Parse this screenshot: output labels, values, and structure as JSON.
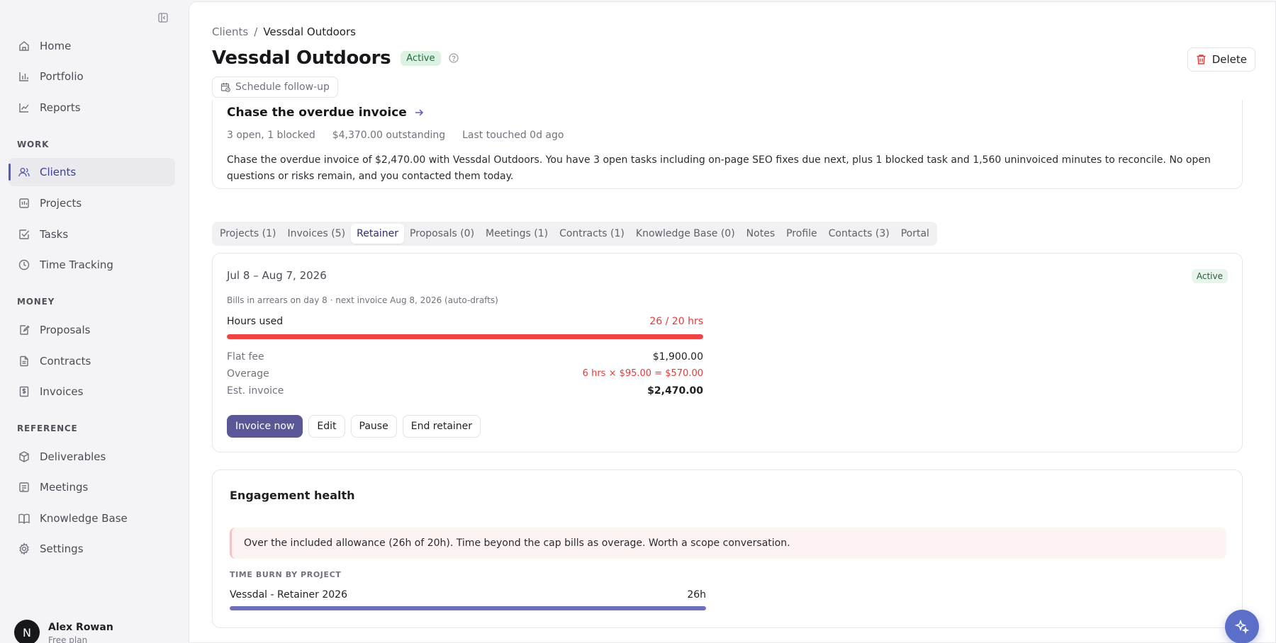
{
  "sidebar": {
    "nav_top": [
      {
        "label": "Home",
        "icon": "home-icon"
      },
      {
        "label": "Portfolio",
        "icon": "bar-chart-icon"
      },
      {
        "label": "Reports",
        "icon": "line-chart-icon"
      }
    ],
    "section_work": "WORK",
    "nav_work": [
      {
        "label": "Clients",
        "icon": "users-icon"
      },
      {
        "label": "Projects",
        "icon": "projects-icon"
      },
      {
        "label": "Tasks",
        "icon": "checkbox-icon"
      },
      {
        "label": "Time Tracking",
        "icon": "clock-icon"
      }
    ],
    "section_money": "MONEY",
    "nav_money": [
      {
        "label": "Proposals",
        "icon": "proposal-icon"
      },
      {
        "label": "Contracts",
        "icon": "contract-icon"
      },
      {
        "label": "Invoices",
        "icon": "invoice-icon"
      }
    ],
    "section_reference": "REFERENCE",
    "nav_reference": [
      {
        "label": "Deliverables",
        "icon": "box-icon"
      },
      {
        "label": "Meetings",
        "icon": "meetings-icon"
      },
      {
        "label": "Knowledge Base",
        "icon": "book-icon"
      },
      {
        "label": "Settings",
        "icon": "gear-icon"
      }
    ],
    "user": {
      "initial": "N",
      "name": "Alex Rowan",
      "plan": "Free plan"
    }
  },
  "header": {
    "breadcrumb_parent": "Clients",
    "breadcrumb_sep": "/",
    "breadcrumb_current": "Vessdal Outdoors",
    "title": "Vessdal Outdoors",
    "status": "Active",
    "delete_label": "Delete",
    "followup_label": "Schedule follow-up"
  },
  "next_action": {
    "title": "Chase the overdue invoice",
    "meta_open": "3 open, 1 blocked",
    "meta_outstanding": "$4,370.00 outstanding",
    "meta_touched": "Last touched 0d ago",
    "description": "Chase the overdue invoice of $2,470.00 with Vessdal Outdoors. You have 3 open tasks including on-page SEO fixes due next, plus 1 blocked task and 1,560 uninvoiced minutes to reconcile. No open questions or risks remain, and you contacted them today."
  },
  "tabs": [
    "Projects (1)",
    "Invoices (5)",
    "Retainer",
    "Proposals (0)",
    "Meetings (1)",
    "Contracts (1)",
    "Knowledge Base (0)",
    "Notes",
    "Profile",
    "Contacts (3)",
    "Portal"
  ],
  "active_tab": "Retainer",
  "retainer": {
    "period": "Jul 8 – Aug 7, 2026",
    "status": "Active",
    "billing_note": "Bills in arrears on day 8 · next invoice Aug 8, 2026 (auto-drafts)",
    "hours_label": "Hours used",
    "hours_value": "26 / 20 hrs",
    "hours_used": 26,
    "hours_included": 20,
    "flat_fee_label": "Flat fee",
    "flat_fee_value": "$1,900.00",
    "overage_label": "Overage",
    "overage_value": "6 hrs × $95.00 = $570.00",
    "est_label": "Est. invoice",
    "est_value": "$2,470.00",
    "buttons": {
      "invoice_now": "Invoice now",
      "edit": "Edit",
      "pause": "Pause",
      "end": "End retainer"
    }
  },
  "health": {
    "title": "Engagement health",
    "alert": "Over the included allowance (26h of 20h). Time beyond the cap bills as overage. Worth a scope conversation.",
    "burn_label": "TIME BURN BY PROJECT",
    "burn_project": "Vessdal - Retainer 2026",
    "burn_hours": "26h",
    "burn_fraction": 1.0
  },
  "colors": {
    "accent": "#5b5796",
    "danger": "#ef4444",
    "burn": "#6d6fb8",
    "fab": "#5b6fc8"
  }
}
